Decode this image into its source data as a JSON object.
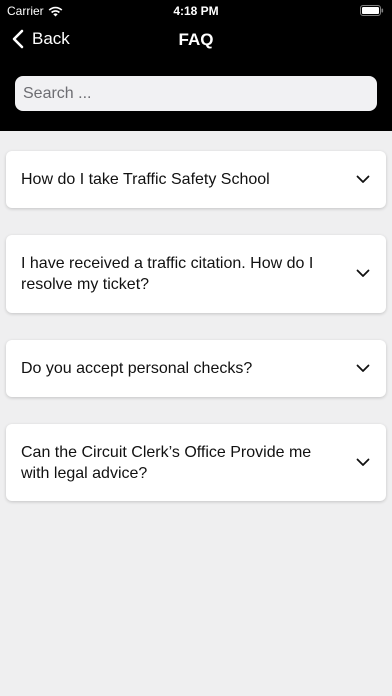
{
  "status_bar": {
    "carrier": "Carrier",
    "time": "4:18 PM"
  },
  "nav": {
    "back_label": "Back",
    "title": "FAQ"
  },
  "search": {
    "placeholder": "Search ...",
    "value": ""
  },
  "faq": {
    "items": [
      {
        "question": "How do I take Traffic Safety School"
      },
      {
        "question": "I have received a traffic citation.  How do I resolve my ticket?"
      },
      {
        "question": "Do you accept personal checks?"
      },
      {
        "question": "Can the Circuit Clerk’s Office Provide me with legal advice?"
      }
    ]
  }
}
